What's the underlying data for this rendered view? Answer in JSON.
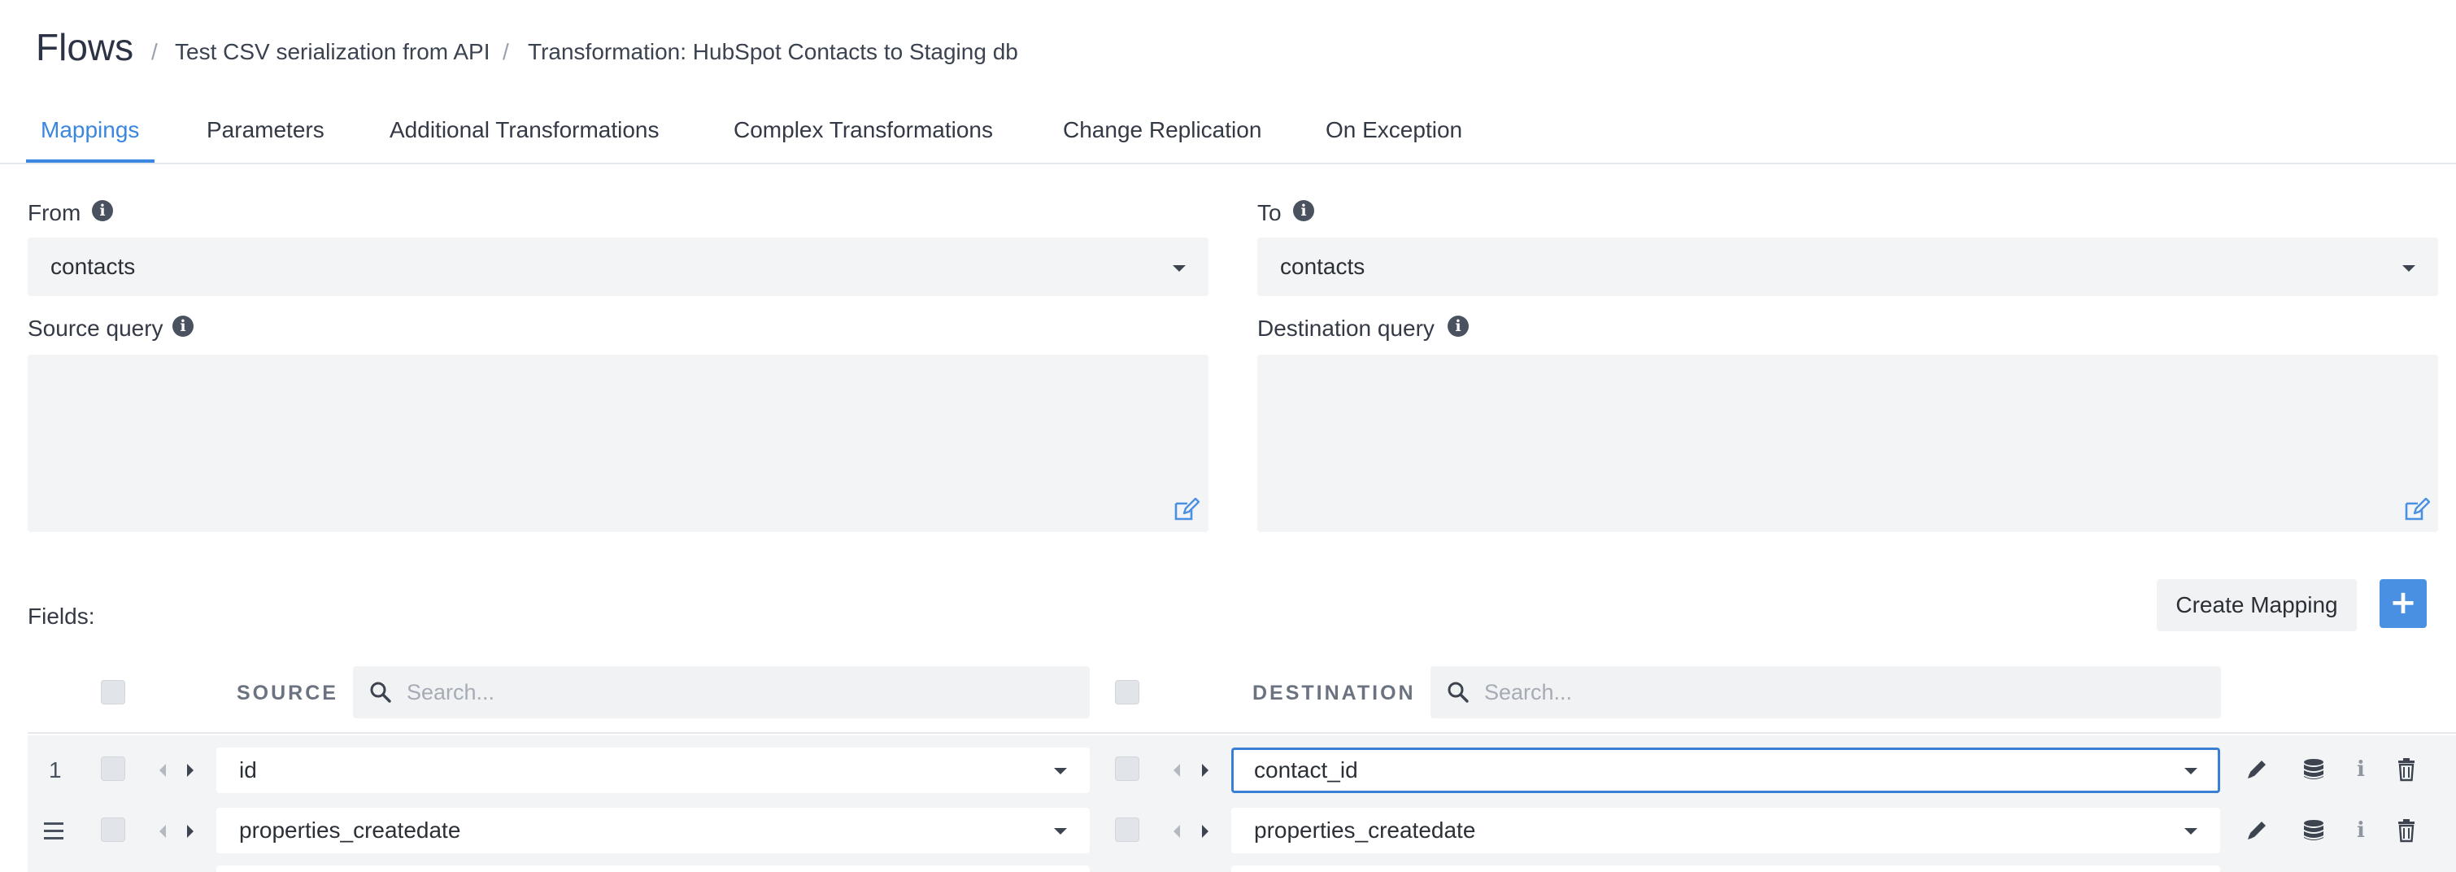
{
  "header": {
    "title": "Flows",
    "separator": "/",
    "breadcrumbs": [
      "Test CSV serialization from API",
      "Transformation: HubSpot Contacts to Staging db"
    ]
  },
  "tabs": [
    {
      "label": "Mappings",
      "active": true
    },
    {
      "label": "Parameters",
      "active": false
    },
    {
      "label": "Additional Transformations",
      "active": false
    },
    {
      "label": "Complex Transformations",
      "active": false
    },
    {
      "label": "Change Replication",
      "active": false
    },
    {
      "label": "On Exception",
      "active": false
    }
  ],
  "from": {
    "label": "From",
    "value": "contacts"
  },
  "to": {
    "label": "To",
    "value": "contacts"
  },
  "source_query": {
    "label": "Source query",
    "value": ""
  },
  "destination_query": {
    "label": "Destination query",
    "value": ""
  },
  "fields": {
    "label": "Fields:",
    "create_mapping_label": "Create Mapping",
    "add_label": "+",
    "source_header": "SOURCE",
    "destination_header": "DESTINATION",
    "source_search_placeholder": "Search...",
    "destination_search_placeholder": "Search..."
  },
  "rows": [
    {
      "index": "1",
      "source": "id",
      "destination": "contact_id",
      "destination_focused": true
    },
    {
      "index": "",
      "source": "properties_createdate",
      "destination": "properties_createdate",
      "destination_focused": false
    }
  ],
  "colors": {
    "accent": "#3a86e0",
    "button_primary": "#4a90e2",
    "field_bg": "#f3f4f6"
  },
  "icons": {
    "info": "info-circle-icon",
    "edit": "edit-pencil-square-icon",
    "search": "search-icon",
    "pencil": "pencil-icon",
    "database": "database-icon",
    "delete": "trash-icon",
    "drag": "hamburger-drag-icon"
  }
}
